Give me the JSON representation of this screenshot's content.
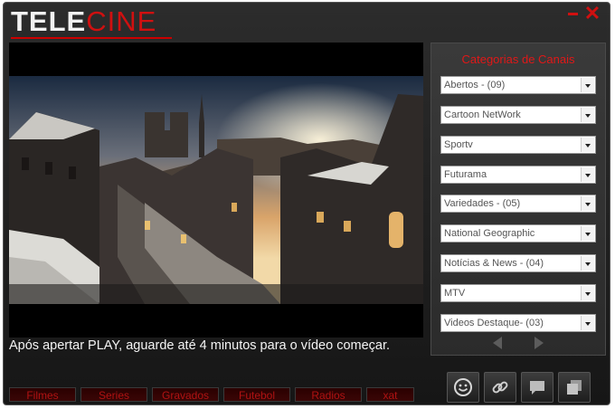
{
  "app": {
    "logo_part1": "TELE",
    "logo_part2": "CINE"
  },
  "window_controls": {
    "minimize_icon": "minimize-icon",
    "close_label": "✕"
  },
  "player": {
    "message": "Após apertar PLAY, aguarde até 4 minutos para o vídeo começar."
  },
  "bottom_tabs": [
    "Filmes",
    "Series",
    "Gravados",
    "Futebol",
    "Radios",
    "xat"
  ],
  "channels": {
    "title": "Categorias de Canais",
    "selects": [
      "Abertos - (09)",
      "Cartoon NetWork",
      "Sportv",
      "Futurama",
      "Variedades - (05)",
      "National Geographic",
      "Notícias & News - (04)",
      "MTV",
      "Videos Destaque- (03)"
    ]
  },
  "toolbar_icons": [
    "smiley-icon",
    "link-icon",
    "chat-icon",
    "windows-icon"
  ],
  "colors": {
    "accent": "#d01010",
    "background": "#222222"
  }
}
